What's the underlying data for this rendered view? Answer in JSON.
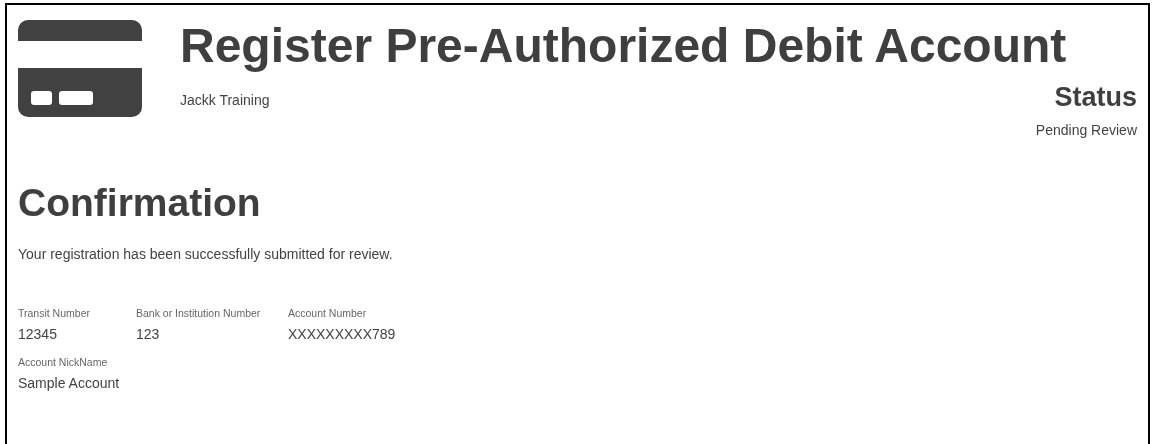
{
  "header": {
    "title": "Register Pre-Authorized Debit Account",
    "subtitle": "Jackk Training",
    "status_heading": "Status",
    "status_value": "Pending Review"
  },
  "confirmation": {
    "heading": "Confirmation",
    "message": "Your registration has been successfully submitted for review."
  },
  "field_rows": [
    [
      {
        "label": "Transit Number",
        "value": "12345"
      },
      {
        "label": "Bank or Institution Number",
        "value": "123"
      },
      {
        "label": "Account Number",
        "value": "XXXXXXXXX789"
      }
    ],
    [
      {
        "label": "Account NickName",
        "value": "Sample Account"
      }
    ]
  ]
}
